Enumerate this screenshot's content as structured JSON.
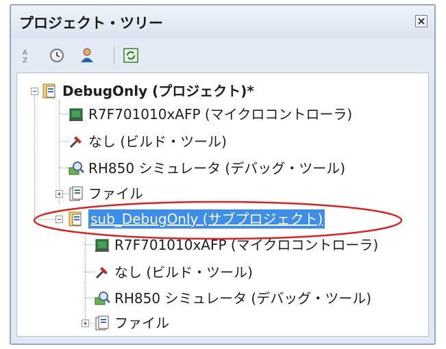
{
  "panel": {
    "title": "プロジェクト・ツリー"
  },
  "toolbar": {
    "buttons": [
      {
        "icon": "sort-icon"
      },
      {
        "icon": "clock-icon"
      },
      {
        "icon": "user-icon"
      },
      {
        "icon": "refresh-icon"
      }
    ]
  },
  "tree": {
    "root": {
      "label": "DebugOnly (プロジェクト)*",
      "expanded": true
    },
    "root_children": [
      {
        "label": "R7F701010xAFP (マイクロコントローラ)",
        "icon": "microcontroller-icon"
      },
      {
        "label": "なし (ビルド・ツール)",
        "icon": "build-tool-icon"
      },
      {
        "label": "RH850 シミュレータ (デバッグ・ツール)",
        "icon": "debug-tool-icon"
      },
      {
        "label": "ファイル",
        "icon": "folder-icon",
        "expanded": false
      }
    ],
    "sub": {
      "label": "sub_DebugOnly (サブプロジェクト)",
      "selected": true,
      "expanded": true
    },
    "sub_children": [
      {
        "label": "R7F701010xAFP (マイクロコントローラ)",
        "icon": "microcontroller-icon"
      },
      {
        "label": "なし (ビルド・ツール)",
        "icon": "build-tool-icon"
      },
      {
        "label": "RH850 シミュレータ (デバッグ・ツール)",
        "icon": "debug-tool-icon"
      },
      {
        "label": "ファイル",
        "icon": "folder-icon",
        "expanded": false
      }
    ]
  },
  "colors": {
    "selection": "#3d8ee8",
    "highlight_ring": "#e02020"
  }
}
